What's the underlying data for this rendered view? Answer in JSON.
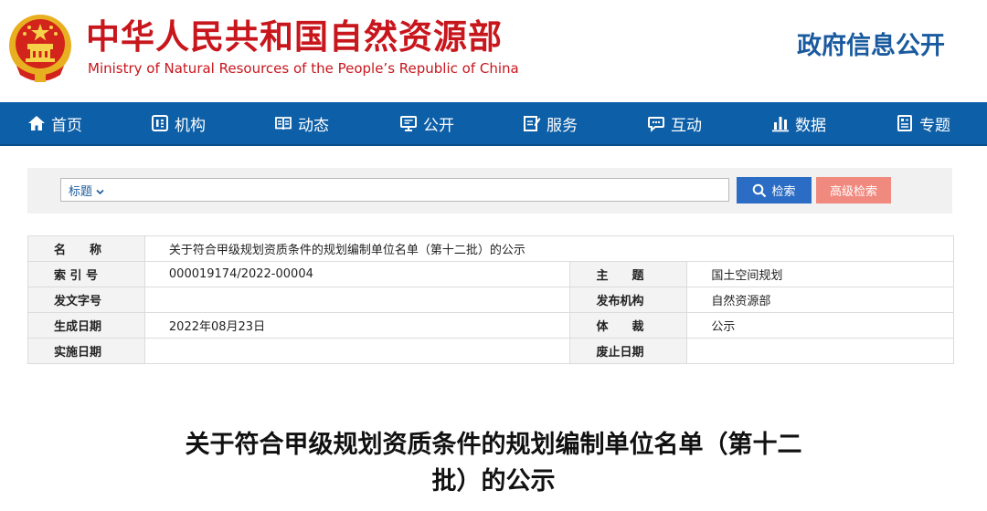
{
  "header": {
    "title_cn": "中华人民共和国自然资源部",
    "title_en": "Ministry of Natural Resources of the People’s Republic of China",
    "gov_info": "政府信息公开"
  },
  "nav": {
    "items": [
      {
        "label": "首页",
        "icon": "home-icon"
      },
      {
        "label": "机构",
        "icon": "organization-icon"
      },
      {
        "label": "动态",
        "icon": "book-icon"
      },
      {
        "label": "公开",
        "icon": "monitor-icon"
      },
      {
        "label": "服务",
        "icon": "edit-icon"
      },
      {
        "label": "互动",
        "icon": "chat-icon"
      },
      {
        "label": "数据",
        "icon": "bar-chart-icon"
      },
      {
        "label": "专题",
        "icon": "document-icon"
      }
    ]
  },
  "search": {
    "field_select": "标题",
    "value": "",
    "search_label": "检索",
    "advanced_label": "高级检索"
  },
  "meta": {
    "name_label": "名　　称",
    "name_value": "关于符合甲级规划资质条件的规划编制单位名单（第十二批）的公示",
    "index_label": "索 引 号",
    "index_value": "000019174/2022-00004",
    "topic_label": "主　　题",
    "topic_value": "国土空间规划",
    "docno_label": "发文字号",
    "docno_value": "",
    "issuer_label": "发布机构",
    "issuer_value": "自然资源部",
    "date_label": "生成日期",
    "date_value": "2022年08月23日",
    "genre_label": "体　　裁",
    "genre_value": "公示",
    "impl_label": "实施日期",
    "impl_value": "",
    "abolish_label": "废止日期",
    "abolish_value": ""
  },
  "article": {
    "title_line1": "关于符合甲级规划资质条件的规划编制单位名单（第十二",
    "title_line2": "批）的公示"
  },
  "colors": {
    "brand_red": "#c8161d",
    "nav_blue": "#0d5fa8",
    "search_blue": "#2b6cc4",
    "advanced_pink": "#f08a7f"
  }
}
